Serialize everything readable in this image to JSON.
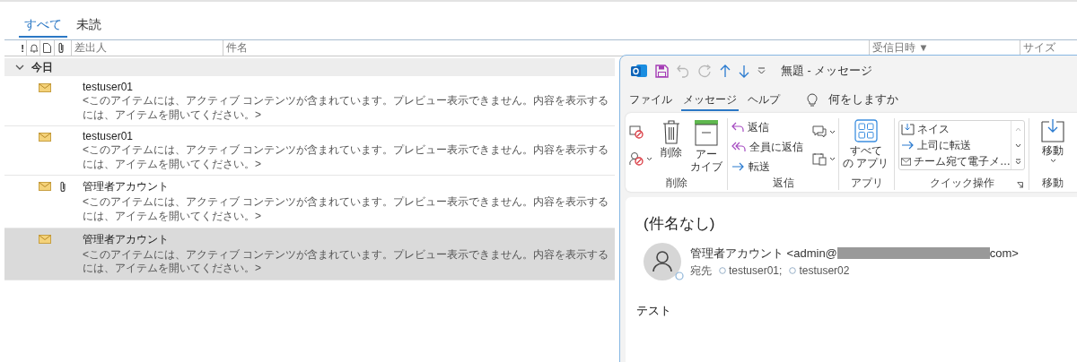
{
  "filter_tabs": [
    {
      "label": "すべて",
      "selected": true
    },
    {
      "label": "未読",
      "selected": false
    }
  ],
  "columns": [
    {
      "kind": "text",
      "label": "!"
    },
    {
      "kind": "bell"
    },
    {
      "kind": "page"
    },
    {
      "kind": "clip"
    },
    {
      "kind": "text",
      "label": "差出人"
    },
    {
      "kind": "text",
      "label": "件名"
    },
    {
      "kind": "text",
      "label": "受信日時 ▼"
    },
    {
      "kind": "text",
      "label": "サイズ"
    }
  ],
  "groups": [
    {
      "label": "今日",
      "expanded": true,
      "messages": [
        {
          "sender": "testuser01",
          "preview": "<このアイテムには、アクティブ コンテンツが含まれています。プレビュー表示できません。内容を表示するには、アイテムを開いてください。>",
          "attachment": false,
          "selected": false
        },
        {
          "sender": "testuser01",
          "preview": "<このアイテムには、アクティブ コンテンツが含まれています。プレビュー表示できません。内容を表示するには、アイテムを開いてください。>",
          "attachment": false,
          "selected": false
        },
        {
          "sender": "管理者アカウント",
          "preview": "<このアイテムには、アクティブ コンテンツが含まれています。プレビュー表示できません。内容を表示するには、アイテムを開いてください。>",
          "attachment": true,
          "selected": false
        },
        {
          "sender": "管理者アカウント",
          "preview": "<このアイテムには、アクティブ コンテンツが含まれています。プレビュー表示できません。内容を表示するには、アイテムを開いてください。>",
          "attachment": false,
          "selected": true
        }
      ]
    }
  ],
  "message_window": {
    "title": "無題 - メッセージ",
    "menu_tabs": [
      {
        "label": "ファイル",
        "selected": false
      },
      {
        "label": "メッセージ",
        "selected": true
      },
      {
        "label": "ヘルプ",
        "selected": false
      }
    ],
    "search": {
      "placeholder": "何をしますか"
    },
    "ribbon": [
      {
        "label": "削除",
        "buttons": [
          {
            "kind": "large",
            "lines": [
              "削除"
            ]
          },
          {
            "kind": "large",
            "lines": [
              "アー",
              "カイブ"
            ]
          }
        ]
      },
      {
        "label": "返信",
        "buttons": [
          {
            "kind": "small",
            "lines": [
              "返信"
            ]
          },
          {
            "kind": "small",
            "lines": [
              "全員に返信"
            ]
          },
          {
            "kind": "small",
            "lines": [
              "転送"
            ]
          }
        ]
      },
      {
        "label": "アプリ",
        "buttons": [
          {
            "kind": "large",
            "lines": [
              "すべて",
              "の アプリ"
            ]
          }
        ]
      },
      {
        "label": "クイック操作",
        "buttons": [
          {
            "kind": "gallery",
            "lines": [
              "ネイス"
            ]
          },
          {
            "kind": "gallery",
            "lines": [
              "上司に転送"
            ]
          },
          {
            "kind": "gallery",
            "lines": [
              "チーム宛て電子メ…"
            ]
          }
        ]
      },
      {
        "label": "移動",
        "buttons": [
          {
            "kind": "large",
            "lines": [
              "移動"
            ]
          }
        ]
      }
    ],
    "subject": "(件名なし)",
    "sender_start": "管理者アカウント <admin@",
    "sender_end": "com>",
    "to_label": "宛先",
    "recipients": [
      "testuser01;",
      "testuser02"
    ],
    "body": "テスト"
  }
}
